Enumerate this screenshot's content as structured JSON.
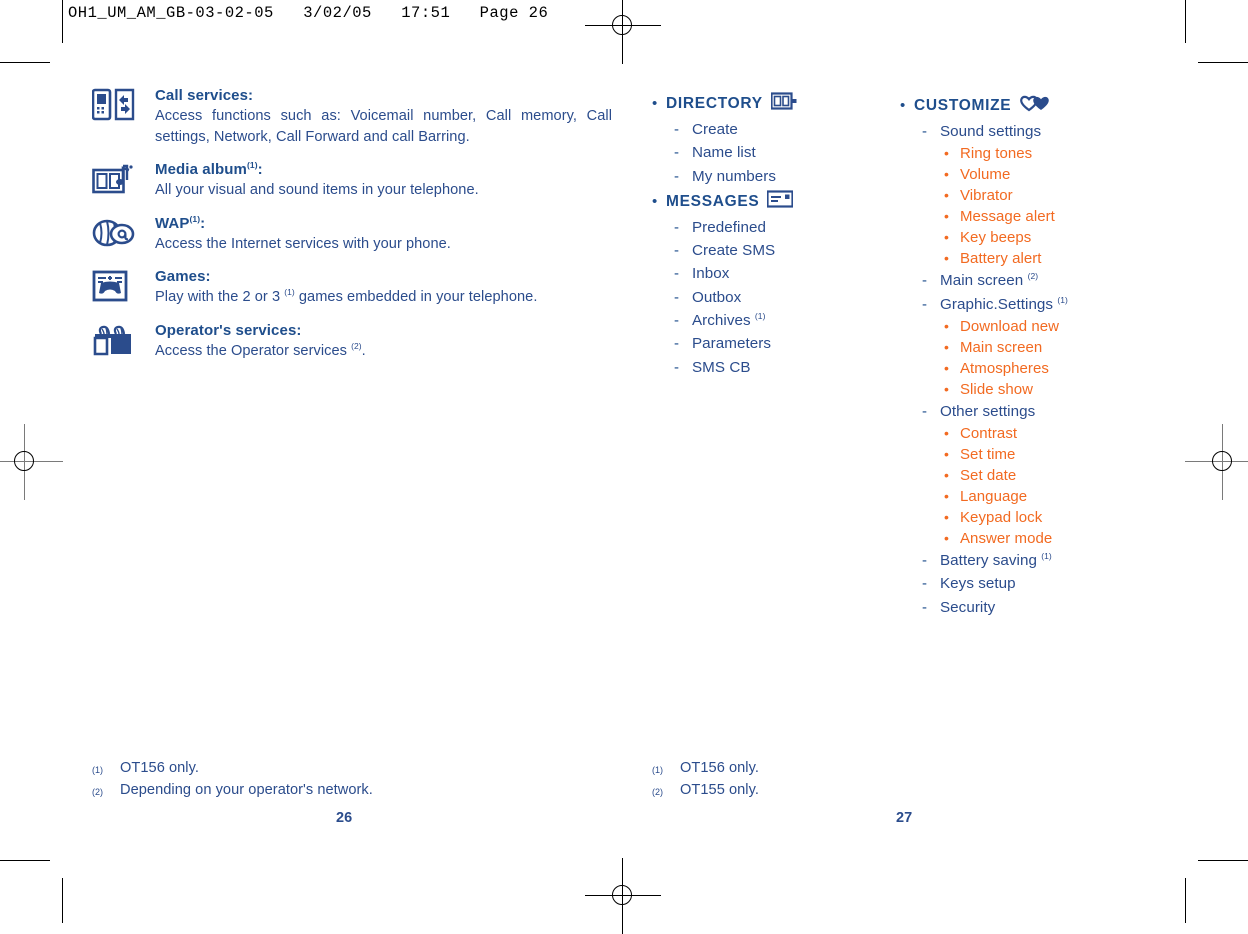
{
  "print_slug": "OH1_UM_AM_GB-03-02-05   3/02/05   17:51   Page 26",
  "colors": {
    "blue_heading": "#1F4E8C",
    "blue_body": "#2B4C8C",
    "orange": "#F26A21"
  },
  "left_page": {
    "features": [
      {
        "icon": "phone-transfer-icon",
        "title": "Call services:",
        "description": "Access functions such as: Voicemail number, Call memory, Call settings, Network, Call Forward and call Barring.",
        "footnote": ""
      },
      {
        "icon": "media-album-icon",
        "title": "Media album",
        "footnote": "(1)",
        "title_suffix": ":",
        "description": "All your visual and sound items in your telephone."
      },
      {
        "icon": "wap-globe-icon",
        "title": "WAP",
        "footnote": "(1)",
        "title_suffix": ":",
        "description": "Access the Internet services with your phone."
      },
      {
        "icon": "games-icon",
        "title": "Games:",
        "footnote": "",
        "description_parts": [
          "Play with the 2 or 3 ",
          "(1)",
          " games embedded in your telephone."
        ]
      },
      {
        "icon": "gift-operator-icon",
        "title": "Operator's services:",
        "footnote": "",
        "description_parts": [
          "Access the Operator services ",
          "(2)",
          "."
        ]
      }
    ],
    "footnotes": [
      {
        "mark": "(1)",
        "text": "OT156 only."
      },
      {
        "mark": "(2)",
        "text": "Depending on your operator's network."
      }
    ],
    "page_number": "26"
  },
  "middle_column": {
    "sections": [
      {
        "title": "DIRECTORY",
        "icon": "directory-card-icon",
        "items": [
          {
            "label": "Create"
          },
          {
            "label": "Name list"
          },
          {
            "label": "My numbers"
          }
        ]
      },
      {
        "title": "MESSAGES",
        "icon": "message-envelope-icon",
        "items": [
          {
            "label": "Predefined"
          },
          {
            "label": "Create SMS"
          },
          {
            "label": "Inbox"
          },
          {
            "label": "Outbox"
          },
          {
            "label": "Archives",
            "footnote": "(1)"
          },
          {
            "label": "Parameters"
          },
          {
            "label": "SMS CB"
          }
        ]
      }
    ]
  },
  "right_column": {
    "sections": [
      {
        "title": "CUSTOMIZE",
        "icon": "hearts-customize-icon",
        "items": [
          {
            "label": "Sound settings",
            "children": [
              "Ring tones",
              "Volume",
              "Vibrator",
              "Message alert",
              "Key beeps",
              "Battery alert"
            ]
          },
          {
            "label": "Main screen",
            "footnote": "(2)",
            "children": []
          },
          {
            "label": "Graphic.Settings",
            "footnote": "(1)",
            "children": [
              "Download new",
              "Main screen",
              "Atmospheres",
              "Slide show"
            ]
          },
          {
            "label": "Other settings",
            "children": [
              "Contrast",
              "Set time",
              "Set date",
              "Language",
              "Keypad lock",
              "Answer mode"
            ]
          },
          {
            "label": "Battery saving",
            "footnote": "(1)",
            "children": []
          },
          {
            "label": "Keys setup",
            "children": []
          },
          {
            "label": "Security",
            "children": []
          }
        ]
      }
    ]
  },
  "right_page": {
    "footnotes": [
      {
        "mark": "(1)",
        "text": "OT156 only."
      },
      {
        "mark": "(2)",
        "text": "OT155 only."
      }
    ],
    "page_number": "27"
  }
}
